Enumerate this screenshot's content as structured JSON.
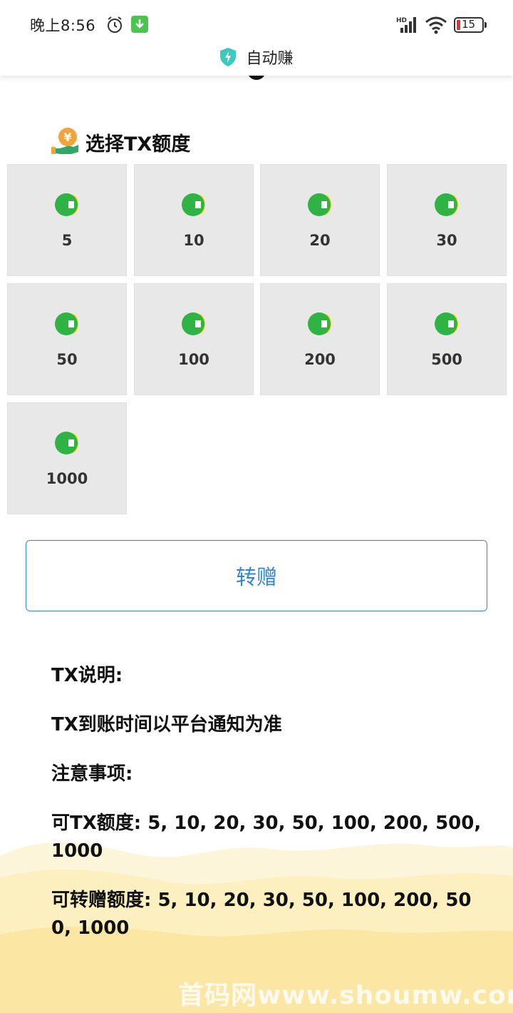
{
  "status_bar": {
    "time": "晚上8:56",
    "battery": "15",
    "network_label": "HD"
  },
  "app": {
    "title": "自动赚",
    "accent_color": "#2f86d6"
  },
  "section": {
    "title": "选择TX额度"
  },
  "amounts": [
    "5",
    "10",
    "20",
    "30",
    "50",
    "100",
    "200",
    "500",
    "1000"
  ],
  "transfer_button": {
    "label": "转赠"
  },
  "notes": [
    "TX说明:",
    "TX到账时间以平台通知为准",
    "注意事项:",
    "可TX额度: 5, 10, 20, 30, 50, 100, 200, 500, 1000",
    "可转赠额度: 5, 10, 20, 30, 50, 100, 200, 500, 1000"
  ],
  "watermark": "首码网www.shoumw.com"
}
